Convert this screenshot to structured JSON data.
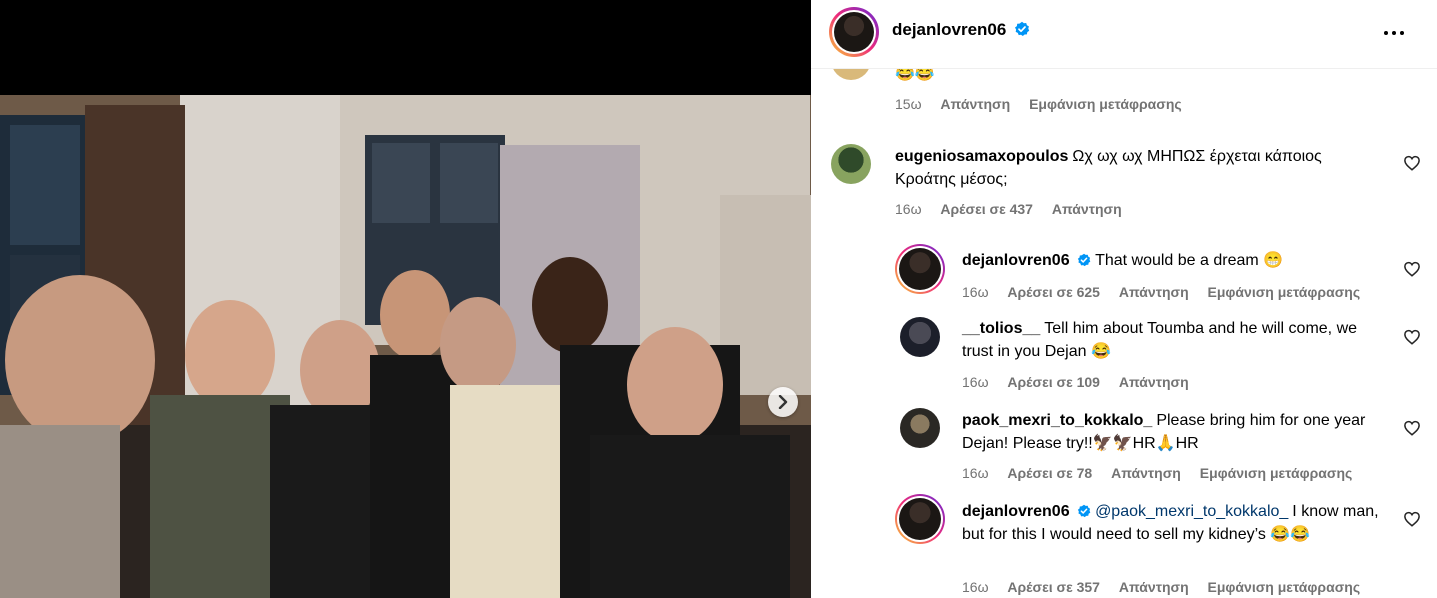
{
  "post": {
    "username": "dejanlovren06",
    "verified": true,
    "media_next_icon": "chevron-right-icon"
  },
  "comments": [
    {
      "partial": true,
      "text": "😂😂",
      "time": "15ω",
      "reply": "Απάντηση",
      "translate": "Εμφάνιση μετάφρασης"
    },
    {
      "username": "eugeniosamaxopoulos",
      "text": "Ωχ ωχ ωχ ΜΗΠΩΣ έρχεται κάποιος Κροάτης μέσος;",
      "time": "16ω",
      "likes": "Αρέσει σε 437",
      "reply": "Απάντηση"
    },
    {
      "username": "dejanlovren06",
      "verified": true,
      "text": "That would be a dream 😁",
      "time": "16ω",
      "likes": "Αρέσει σε 625",
      "reply": "Απάντηση",
      "translate": "Εμφάνιση μετάφρασης"
    },
    {
      "username": "__tolios__",
      "text": "Tell him about Toumba and he will come, we trust in you Dejan 😂",
      "time": "16ω",
      "likes": "Αρέσει σε 109",
      "reply": "Απάντηση"
    },
    {
      "username": "paok_mexri_to_kokkalo_",
      "text": "Please bring him for one year Dejan! Please try!!🦅🦅HR🙏HR",
      "time": "16ω",
      "likes": "Αρέσει σε 78",
      "reply": "Απάντηση",
      "translate": "Εμφάνιση μετάφρασης"
    },
    {
      "username": "dejanlovren06",
      "verified": true,
      "mention": "@paok_mexri_to_kokkalo_",
      "text": "I know man, but for this I would need to sell my kidney’s 😂😂",
      "time": "16ω",
      "likes": "Αρέσει σε 357",
      "reply": "Απάντηση",
      "translate": "Εμφάνιση μετάφρασης"
    }
  ]
}
